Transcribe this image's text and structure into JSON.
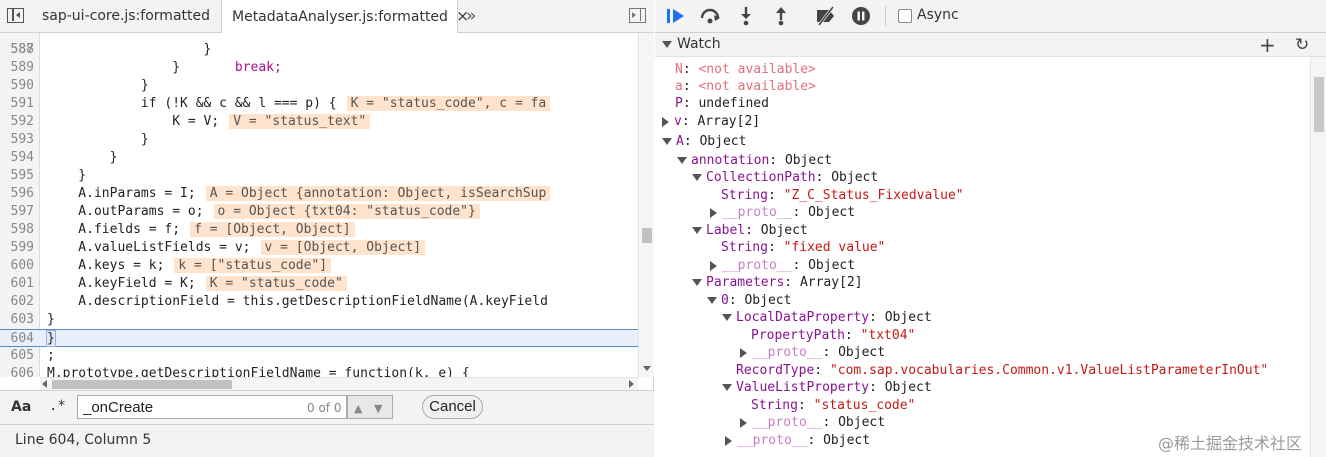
{
  "tabs": [
    {
      "label": "sap-ui-core.js:formatted",
      "active": false
    },
    {
      "label": "MetadataAnalyser.js:formatted",
      "active": true
    }
  ],
  "tab_close_glyph": "×",
  "tab_more_glyph": "»",
  "code": {
    "top_fragment": "break;",
    "lines": [
      {
        "num": "588",
        "text": "                    }"
      },
      {
        "num": "589",
        "text": "                }"
      },
      {
        "num": "590",
        "text": "            }"
      },
      {
        "num": "591",
        "text": "            if (!K && c && l === p) {",
        "inline": "K = \"status_code\", c = fa"
      },
      {
        "num": "592",
        "text": "                K = V;",
        "inline": "V = \"status_text\""
      },
      {
        "num": "593",
        "text": "            }"
      },
      {
        "num": "594",
        "text": "        }"
      },
      {
        "num": "595",
        "text": "    }"
      },
      {
        "num": "596",
        "text": "    A.inParams = I;",
        "inline": "A = Object {annotation: Object, isSearchSup"
      },
      {
        "num": "597",
        "text": "    A.outParams = o;",
        "inline": "o = Object {txt04: \"status_code\"}"
      },
      {
        "num": "598",
        "text": "    A.fields = f;",
        "inline": "f = [Object, Object]"
      },
      {
        "num": "599",
        "text": "    A.valueListFields = v;",
        "inline": "v = [Object, Object]"
      },
      {
        "num": "600",
        "text": "    A.keys = k;",
        "inline": "k = [\"status_code\"]"
      },
      {
        "num": "601",
        "text": "    A.keyField = K;",
        "inline": "K = \"status_code\""
      },
      {
        "num": "602",
        "text": "    A.descriptionField = this.getDescriptionFieldName(A.keyField"
      },
      {
        "num": "603",
        "text": "}"
      },
      {
        "num": "604",
        "text": "}"
      },
      {
        "num": "605",
        "text": ";"
      },
      {
        "num": "606",
        "text": "M.prototype.getDescriptionFieldName = function(k, e) {"
      }
    ]
  },
  "search": {
    "case_label": "Aa",
    "regex_label": ".*",
    "value": "_onCreate",
    "match_count": "0 of 0",
    "cancel_label": "Cancel"
  },
  "status": {
    "position": "Line 604, Column 5"
  },
  "debugger": {
    "async_label": "Async",
    "async_checked": false
  },
  "watch": {
    "title": "Watch",
    "add_glyph": "+",
    "refresh_glyph": "↻",
    "rows": [
      {
        "key": "N",
        "sep": ": ",
        "value": "<not available>"
      },
      {
        "key": "a",
        "sep": ": ",
        "value": "<not available>"
      },
      {
        "key": "P",
        "sep": ": ",
        "value": "undefined"
      },
      {
        "key": "v",
        "sep": ": ",
        "value": "Array[2]"
      },
      {
        "key": "A",
        "sep": ": ",
        "value": "Object"
      },
      {
        "key": "annotation",
        "sep": ": ",
        "value": "Object"
      },
      {
        "key": "CollectionPath",
        "sep": ": ",
        "value": "Object"
      },
      {
        "key": "String",
        "sep": ": ",
        "value": "\"Z_C_Status_Fixedvalue\""
      },
      {
        "key": "__proto__",
        "sep": ": ",
        "value": "Object"
      },
      {
        "key": "Label",
        "sep": ": ",
        "value": "Object"
      },
      {
        "key": "String",
        "sep": ": ",
        "value": "\"fixed value\""
      },
      {
        "key": "__proto__",
        "sep": ": ",
        "value": "Object"
      },
      {
        "key": "Parameters",
        "sep": ": ",
        "value": "Array[2]"
      },
      {
        "key": "0",
        "sep": ": ",
        "value": "Object"
      },
      {
        "key": "LocalDataProperty",
        "sep": ": ",
        "value": "Object"
      },
      {
        "key": "PropertyPath",
        "sep": ": ",
        "value": "\"txt04\""
      },
      {
        "key": "__proto__",
        "sep": ": ",
        "value": "Object"
      },
      {
        "key": "RecordType",
        "sep": ": ",
        "value": "\"com.sap.vocabularies.Common.v1.ValueListParameterInOut\""
      },
      {
        "key": "ValueListProperty",
        "sep": ": ",
        "value": "Object"
      },
      {
        "key": "String",
        "sep": ": ",
        "value": "\"status_code\""
      },
      {
        "key": "__proto__",
        "sep": ": ",
        "value": "Object"
      },
      {
        "key": "__proto__",
        "sep": ": ",
        "value": "Object"
      }
    ]
  },
  "watermark": "@稀土掘金技术社区"
}
